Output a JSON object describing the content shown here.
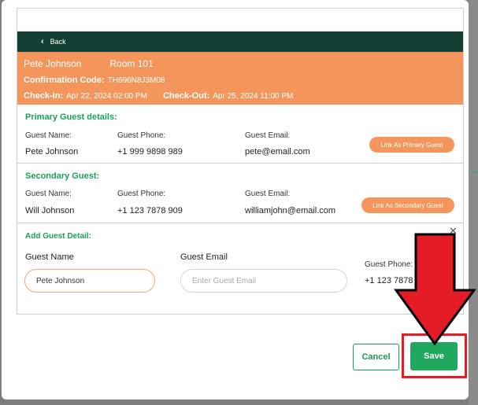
{
  "back_label": "Back",
  "booking": {
    "guest_name": "Pete Johnson",
    "room": "Room 101",
    "confirmation_label": "Confirmation Code:",
    "confirmation_code": "TH696N8J3M08",
    "checkin_label": "Check-In:",
    "checkin_value": "Apr 22, 2024  02:00 PM",
    "checkout_label": "Check-Out:",
    "checkout_value": "Apr 25, 2024  11:00 PM",
    "banner_color": "#f4965c"
  },
  "primary_guest": {
    "title": "Primary Guest details:",
    "name_label": "Guest Name:",
    "name": "Pete Johnson",
    "phone_label": "Guest Phone:",
    "phone": "+1 999 9898 989",
    "email_label": "Guest Email:",
    "email": "pete@email.com",
    "link_button": "Link As Primary Guest"
  },
  "secondary_guest": {
    "title": "Secondary Guest:",
    "name_label": "Guest Name:",
    "name": "Will Johnson",
    "phone_label": "Guest Phone:",
    "phone": "+1 123 7878 909",
    "email_label": "Guest Email:",
    "email": "williamjohn@email.com",
    "link_button": "Link As Secondary Guest"
  },
  "add_guest": {
    "title": "Add Guest Detail:",
    "name_label": "Guest Name",
    "name_value": "Pete Johnson",
    "email_label": "Guest Email",
    "email_placeholder": "Enter Guest Email",
    "phone_label": "Guest Phone:",
    "phone_value": "+1 123 7878"
  },
  "actions": {
    "cancel_label": "Cancel",
    "save_label": "Save"
  },
  "colors": {
    "header_dark": "#143f35",
    "accent_orange": "#f4965c",
    "accent_green": "#1fa85e",
    "annotation_red": "#e41c25"
  }
}
